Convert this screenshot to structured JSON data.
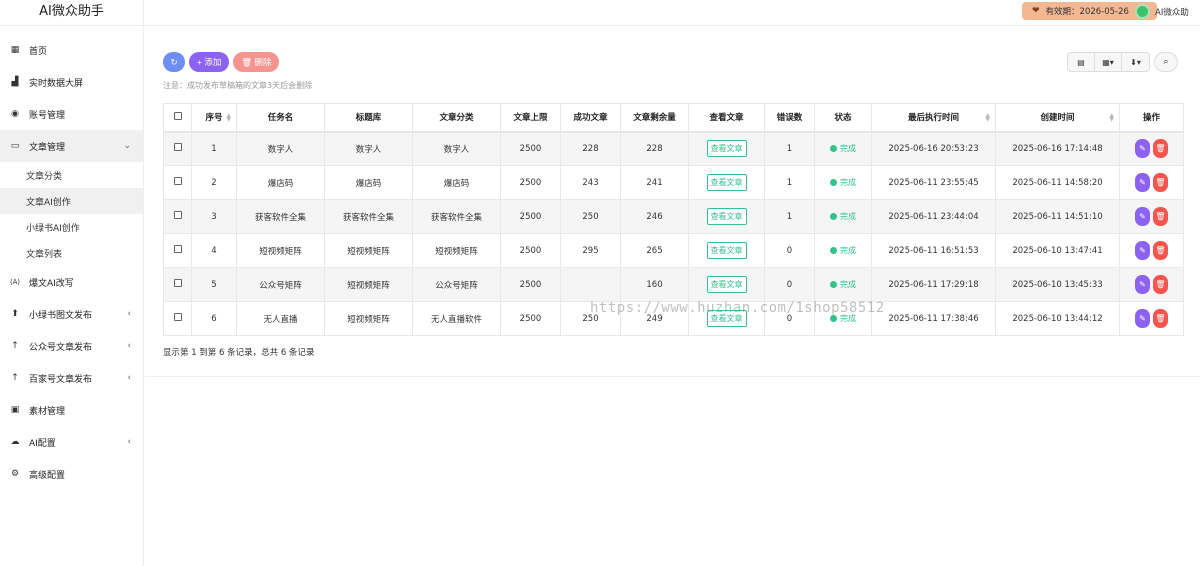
{
  "app": {
    "title": "AI微众助手"
  },
  "topbar": {
    "validity_label": "有效期：2026-05-26",
    "user_name": "AI微众助",
    "accent": "#f3b791"
  },
  "sidebar": {
    "items": [
      {
        "label": "首页",
        "icon": "bar-chart-icon",
        "glyph": "▦"
      },
      {
        "label": "实时数据大屏",
        "icon": "area-chart-icon",
        "glyph": "▟"
      },
      {
        "label": "账号管理",
        "icon": "wechat-icon",
        "glyph": "◉"
      },
      {
        "label": "文章管理",
        "icon": "folder-open-icon",
        "glyph": "▭",
        "chevron": "⌄"
      },
      {
        "label": "爆文AI改写",
        "icon": "ai-badge-icon",
        "glyph": "⟨A⟩"
      },
      {
        "label": "小绿书图文发布",
        "icon": "upload-icon",
        "glyph": "⬆",
        "chevron": "‹"
      },
      {
        "label": "公众号文章发布",
        "icon": "arrow-up-icon",
        "glyph": "↑",
        "chevron": "‹"
      },
      {
        "label": "百家号文章发布",
        "icon": "arrow-up-icon",
        "glyph": "↑",
        "chevron": "‹"
      },
      {
        "label": "素材管理",
        "icon": "image-icon",
        "glyph": "▣"
      },
      {
        "label": "AI配置",
        "icon": "cloud-icon",
        "glyph": "☁",
        "chevron": "‹"
      },
      {
        "label": "高级配置",
        "icon": "gear-icon",
        "glyph": "⚙"
      }
    ],
    "subitems": [
      "文章分类",
      "文章AI创作",
      "小绿书AI创作",
      "文章列表"
    ]
  },
  "toolbar": {
    "refresh_glyph": "↻",
    "add_label": "+ 添加",
    "delete_label": "🗑 删除",
    "notice": "注意：成功发布草稿箱的文章3天后会删除"
  },
  "table": {
    "headers": [
      "序号",
      "任务名",
      "标题库",
      "文章分类",
      "文章上限",
      "成功文章",
      "文章剩余量",
      "查看文章",
      "错误数",
      "状态",
      "最后执行时间",
      "创建时间",
      "操作"
    ],
    "view_label": "查看文章",
    "status_label": "完成",
    "rows": [
      {
        "no": "1",
        "task": "数字人",
        "lib": "数字人",
        "cat": "数字人",
        "limit": "2500",
        "ok": "228",
        "left": "228",
        "err": "1",
        "last": "2025-06-16 20:53:23",
        "created": "2025-06-16 17:14:48"
      },
      {
        "no": "2",
        "task": "爆店码",
        "lib": "爆店码",
        "cat": "爆店码",
        "limit": "2500",
        "ok": "243",
        "left": "241",
        "err": "1",
        "last": "2025-06-11 23:55:45",
        "created": "2025-06-11 14:58:20"
      },
      {
        "no": "3",
        "task": "获客软件全集",
        "lib": "获客软件全集",
        "cat": "获客软件全集",
        "limit": "2500",
        "ok": "250",
        "left": "246",
        "err": "1",
        "last": "2025-06-11 23:44:04",
        "created": "2025-06-11 14:51:10"
      },
      {
        "no": "4",
        "task": "短视频矩阵",
        "lib": "短视频矩阵",
        "cat": "短视频矩阵",
        "limit": "2500",
        "ok": "295",
        "left": "265",
        "err": "0",
        "last": "2025-06-11 16:51:53",
        "created": "2025-06-10 13:47:41"
      },
      {
        "no": "5",
        "task": "公众号矩阵",
        "lib": "短视频矩阵",
        "cat": "公众号矩阵",
        "limit": "2500",
        "ok": "",
        "left": "160",
        "err": "0",
        "last": "2025-06-11 17:29:18",
        "created": "2025-06-10 13:45:33"
      },
      {
        "no": "6",
        "task": "无人直播",
        "lib": "短视频矩阵",
        "cat": "无人直播软件",
        "limit": "2500",
        "ok": "250",
        "left": "249",
        "err": "0",
        "last": "2025-06-11 17:38:46",
        "created": "2025-06-10 13:44:12"
      }
    ]
  },
  "pagination": {
    "info": "显示第 1 到第 6 条记录，总共 6 条记录"
  },
  "watermark": "https://www.huzhan.com/1shop58512"
}
